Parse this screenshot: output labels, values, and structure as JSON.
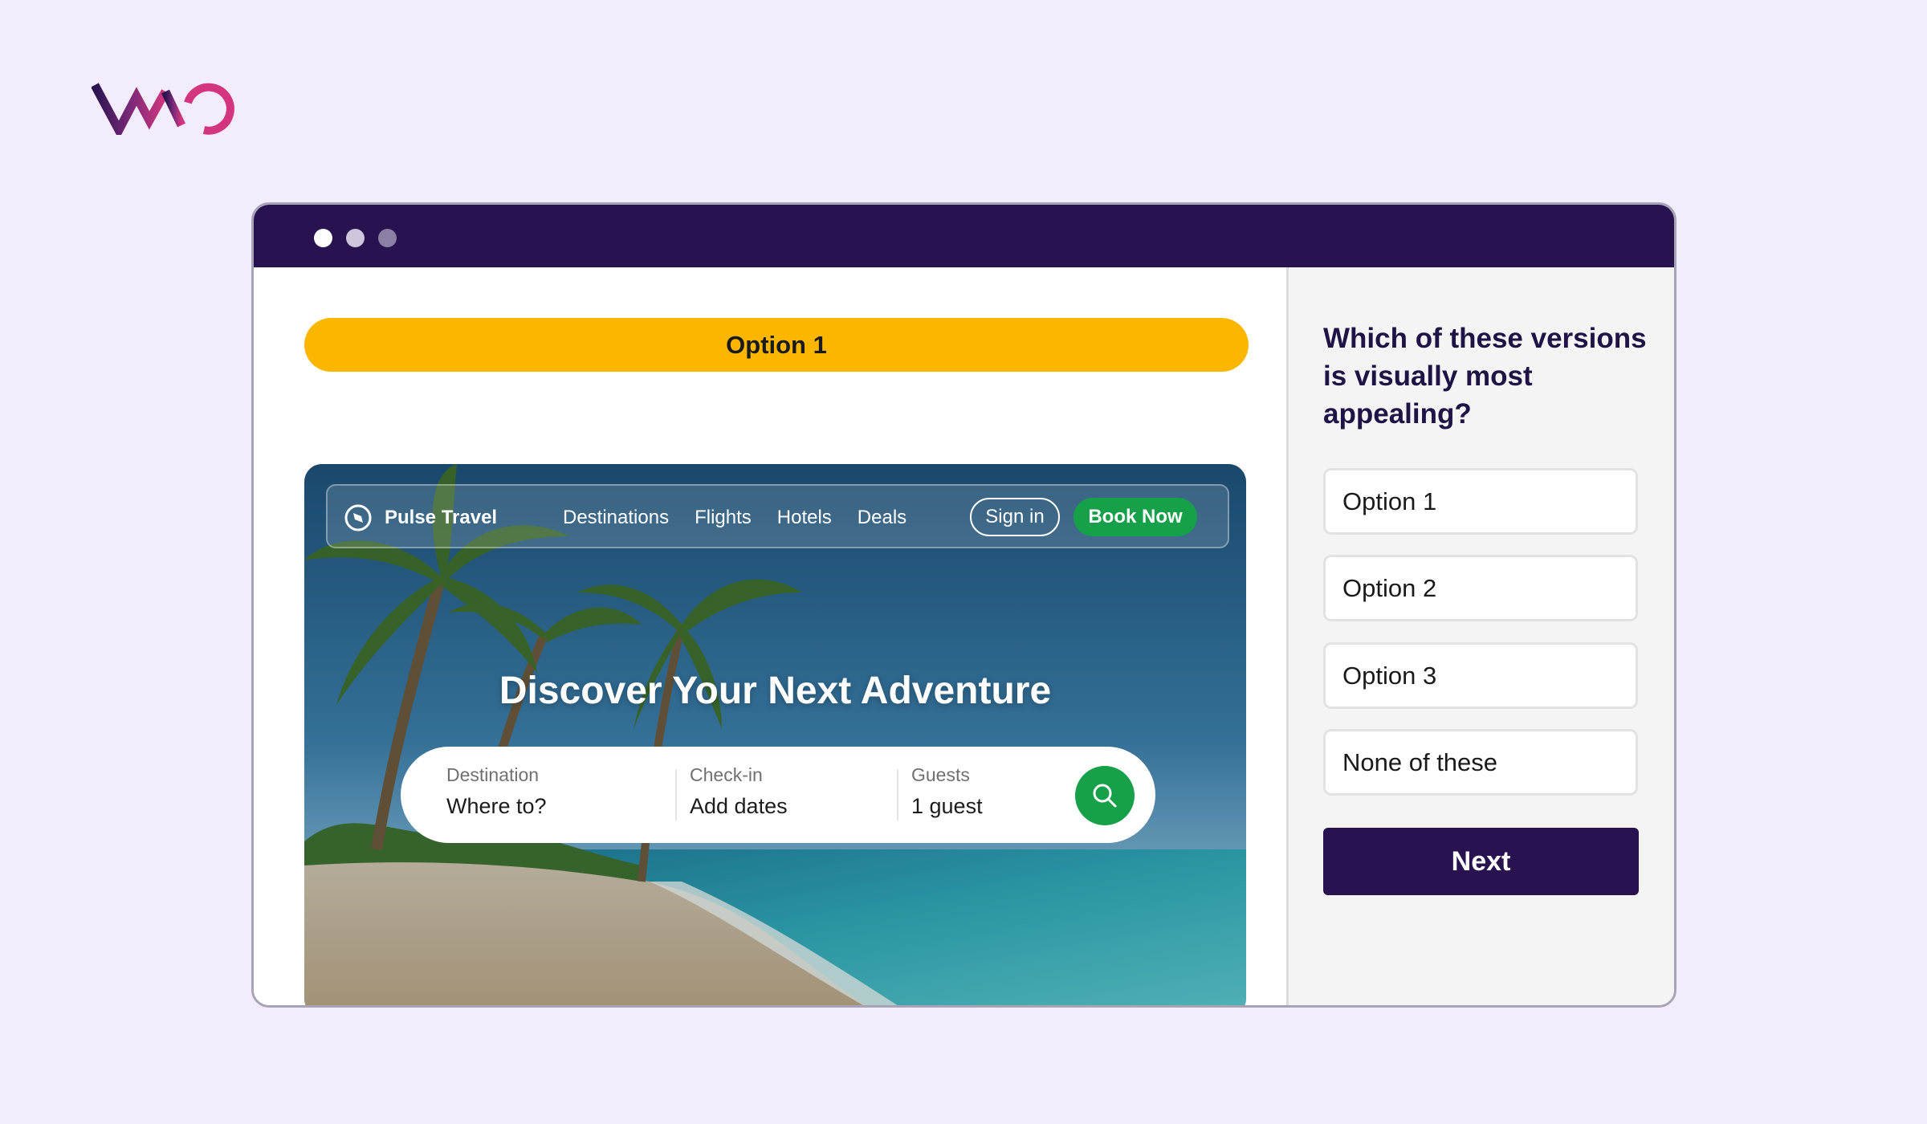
{
  "brand": {
    "logo": "VWO"
  },
  "colors": {
    "page_bg": "#f3ecfd",
    "titlebar": "#28124f",
    "banner": "#fbb700",
    "accent_green": "#16a04a",
    "next_button": "#28124f"
  },
  "variant": {
    "label": "Option 1"
  },
  "site": {
    "brand_icon": "compass-icon",
    "name": "Pulse Travel",
    "nav": [
      "Destinations",
      "Flights",
      "Hotels",
      "Deals"
    ],
    "signin": "Sign in",
    "book": "Book Now",
    "headline": "Discover Your Next Adventure",
    "search": {
      "destination_label": "Destination",
      "destination_value": "Where to?",
      "checkin_label": "Check-in",
      "checkin_value": "Add dates",
      "guests_label": "Guests",
      "guests_value": "1 guest",
      "button_icon": "search-icon"
    }
  },
  "survey": {
    "question": "Which of these versions is visually most appealing?",
    "options": [
      "Option 1",
      "Option 2",
      "Option 3",
      "None of these"
    ],
    "next": "Next"
  }
}
